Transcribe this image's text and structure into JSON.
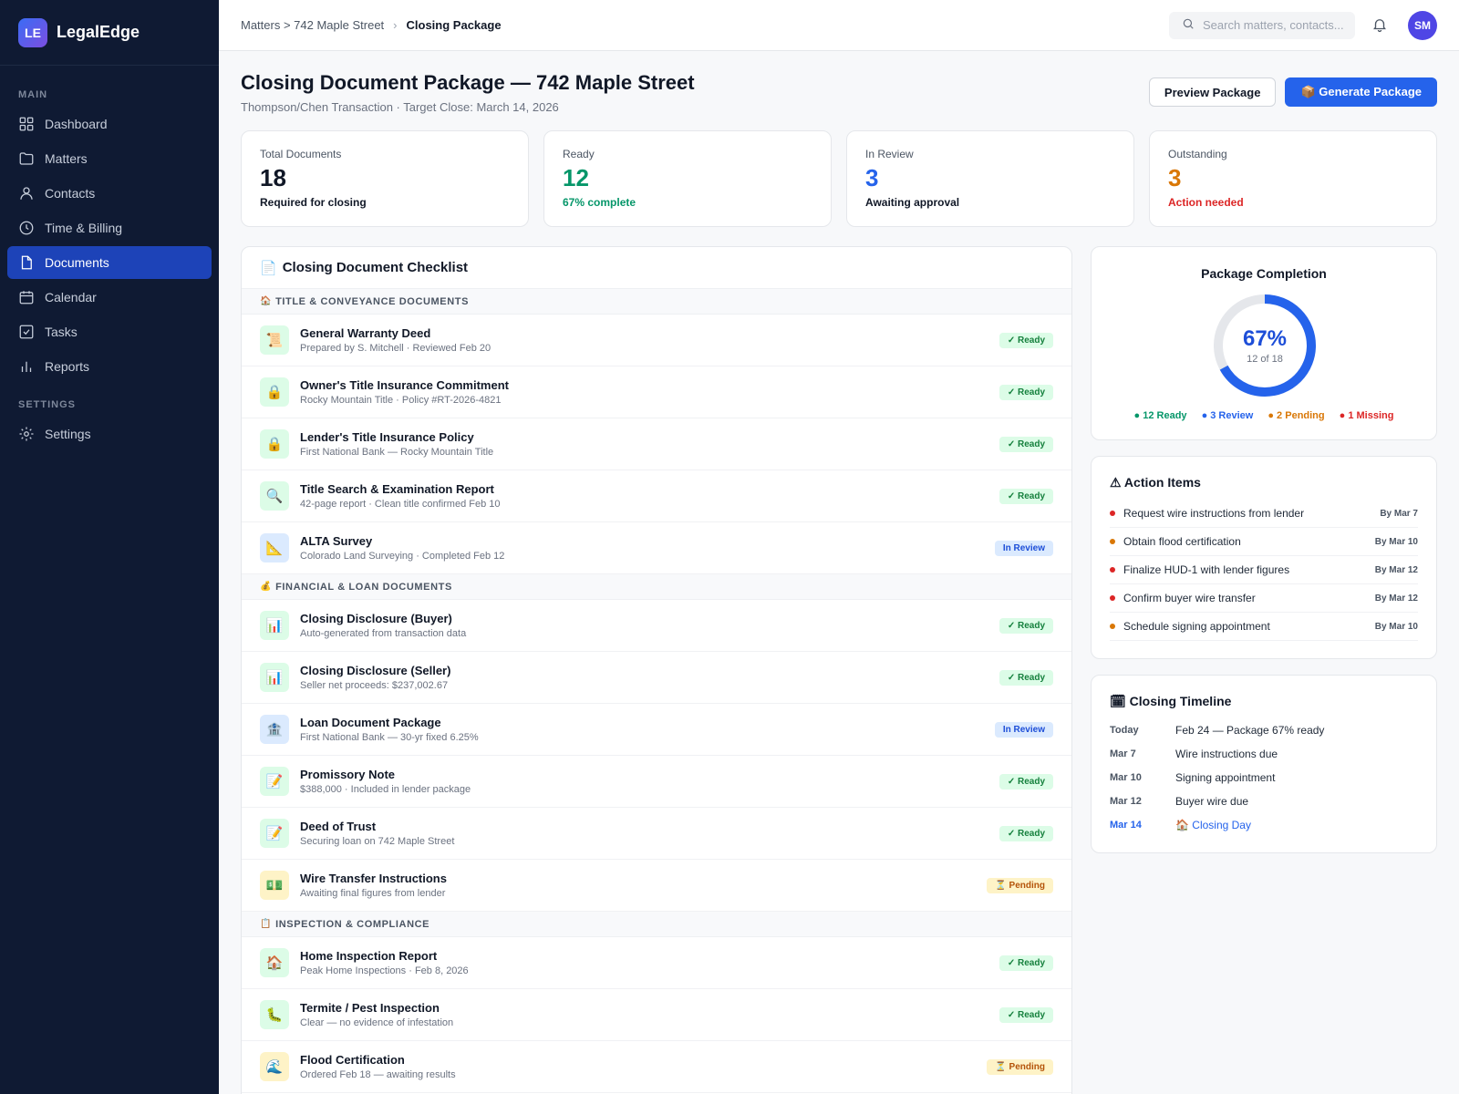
{
  "app": {
    "logo": "LE",
    "name": "LegalEdge"
  },
  "sidebar": {
    "main_label": "MAIN",
    "settings_label": "SETTINGS",
    "items": [
      {
        "label": "Dashboard",
        "icon": "grid-icon"
      },
      {
        "label": "Matters",
        "icon": "folder-icon"
      },
      {
        "label": "Contacts",
        "icon": "person-icon"
      },
      {
        "label": "Time & Billing",
        "icon": "clock-icon"
      },
      {
        "label": "Documents",
        "icon": "document-icon",
        "active": true
      },
      {
        "label": "Calendar",
        "icon": "calendar-icon"
      },
      {
        "label": "Tasks",
        "icon": "checkbox-icon"
      },
      {
        "label": "Reports",
        "icon": "bar-chart-icon"
      }
    ],
    "settings_item": {
      "label": "Settings",
      "icon": "gear-icon"
    }
  },
  "topbar": {
    "breadcrumb_parent": "Matters > 742 Maple Street",
    "breadcrumb_current": "Closing Package",
    "search_placeholder": "Search matters, contacts...",
    "avatar_initials": "SM"
  },
  "header": {
    "title": "Closing Document Package — 742 Maple Street",
    "subtitle": "Thompson/Chen Transaction · Target Close: March 14, 2026",
    "preview_button": "Preview Package",
    "generate_button": "📦 Generate Package"
  },
  "stats": [
    {
      "label": "Total Documents",
      "value": "18",
      "note": "Required for closing",
      "value_color": "#111827",
      "note_color": "#111827"
    },
    {
      "label": "Ready",
      "value": "12",
      "note": "67% complete",
      "value_color": "#059669",
      "note_color": "#059669"
    },
    {
      "label": "In Review",
      "value": "3",
      "note": "Awaiting approval",
      "value_color": "#2563eb",
      "note_color": "#111827"
    },
    {
      "label": "Outstanding",
      "value": "3",
      "note": "Action needed",
      "value_color": "#d97706",
      "note_color": "#dc2626"
    }
  ],
  "checklist": {
    "title": "Closing Document Checklist",
    "title_icon": "📄",
    "sections": [
      {
        "icon": "🏠",
        "label": "TITLE & CONVEYANCE DOCUMENTS",
        "docs": [
          {
            "icon": "📜",
            "tone": "green",
            "name": "General Warranty Deed",
            "meta": "Prepared by S. Mitchell · Reviewed Feb 20",
            "status": "✓ Ready",
            "kind": "ready"
          },
          {
            "icon": "🔒",
            "tone": "green",
            "name": "Owner's Title Insurance Commitment",
            "meta": "Rocky Mountain Title · Policy #RT-2026-4821",
            "status": "✓ Ready",
            "kind": "ready"
          },
          {
            "icon": "🔒",
            "tone": "green",
            "name": "Lender's Title Insurance Policy",
            "meta": "First National Bank — Rocky Mountain Title",
            "status": "✓ Ready",
            "kind": "ready"
          },
          {
            "icon": "🔍",
            "tone": "green",
            "name": "Title Search & Examination Report",
            "meta": "42-page report · Clean title confirmed Feb 10",
            "status": "✓ Ready",
            "kind": "ready"
          },
          {
            "icon": "📐",
            "tone": "blue",
            "name": "ALTA Survey",
            "meta": "Colorado Land Surveying · Completed Feb 12",
            "status": "In Review",
            "kind": "review"
          }
        ]
      },
      {
        "icon": "💰",
        "label": "FINANCIAL & LOAN DOCUMENTS",
        "docs": [
          {
            "icon": "📊",
            "tone": "green",
            "name": "Closing Disclosure (Buyer)",
            "meta": "Auto-generated from transaction data",
            "status": "✓ Ready",
            "kind": "ready"
          },
          {
            "icon": "📊",
            "tone": "green",
            "name": "Closing Disclosure (Seller)",
            "meta": "Seller net proceeds: $237,002.67",
            "status": "✓ Ready",
            "kind": "ready"
          },
          {
            "icon": "🏦",
            "tone": "blue",
            "name": "Loan Document Package",
            "meta": "First National Bank — 30-yr fixed 6.25%",
            "status": "In Review",
            "kind": "review"
          },
          {
            "icon": "📝",
            "tone": "green",
            "name": "Promissory Note",
            "meta": "$388,000 · Included in lender package",
            "status": "✓ Ready",
            "kind": "ready"
          },
          {
            "icon": "📝",
            "tone": "green",
            "name": "Deed of Trust",
            "meta": "Securing loan on 742 Maple Street",
            "status": "✓ Ready",
            "kind": "ready"
          },
          {
            "icon": "💵",
            "tone": "amber",
            "name": "Wire Transfer Instructions",
            "meta": "Awaiting final figures from lender",
            "status": "⏳ Pending",
            "kind": "pending"
          }
        ]
      },
      {
        "icon": "📋",
        "label": "INSPECTION & COMPLIANCE",
        "docs": [
          {
            "icon": "🏠",
            "tone": "green",
            "name": "Home Inspection Report",
            "meta": "Peak Home Inspections · Feb 8, 2026",
            "status": "✓ Ready",
            "kind": "ready"
          },
          {
            "icon": "🐛",
            "tone": "green",
            "name": "Termite / Pest Inspection",
            "meta": "Clear — no evidence of infestation",
            "status": "✓ Ready",
            "kind": "ready"
          },
          {
            "icon": "🌊",
            "tone": "amber",
            "name": "Flood Certification",
            "meta": "Ordered Feb 18 — awaiting results",
            "status": "⏳ Pending",
            "kind": "pending"
          }
        ]
      }
    ]
  },
  "completion": {
    "title": "Package Completion",
    "percent_label": "67%",
    "progress": 0.67,
    "sub": "12 of 18",
    "ring_color": "#2563eb",
    "track_color": "#e5e7eb",
    "legend": [
      {
        "text": "● 12 Ready",
        "color": "#059669"
      },
      {
        "text": "● 3 Review",
        "color": "#2563eb"
      },
      {
        "text": "● 2 Pending",
        "color": "#d97706"
      },
      {
        "text": "● 1 Missing",
        "color": "#dc2626"
      }
    ]
  },
  "action_items": {
    "title": "⚠ Action Items",
    "items": [
      {
        "text": "Request wire instructions from lender",
        "due": "By Mar 7",
        "color": "#dc2626"
      },
      {
        "text": "Obtain flood certification",
        "due": "By Mar 10",
        "color": "#d97706"
      },
      {
        "text": "Finalize HUD-1 with lender figures",
        "due": "By Mar 12",
        "color": "#dc2626"
      },
      {
        "text": "Confirm buyer wire transfer",
        "due": "By Mar 12",
        "color": "#dc2626"
      },
      {
        "text": "Schedule signing appointment",
        "due": "By Mar 10",
        "color": "#d97706"
      }
    ]
  },
  "timeline": {
    "title": "🗓 Closing Timeline",
    "rows": [
      {
        "date": "Today",
        "event": "Feb 24 — Package 67% ready",
        "highlight": false
      },
      {
        "date": "Mar 7",
        "event": "Wire instructions due",
        "highlight": false
      },
      {
        "date": "Mar 10",
        "event": "Signing appointment",
        "highlight": false
      },
      {
        "date": "Mar 12",
        "event": "Buyer wire due",
        "highlight": false
      },
      {
        "date": "Mar 14",
        "event": "🏠 Closing Day",
        "highlight": true
      }
    ]
  }
}
